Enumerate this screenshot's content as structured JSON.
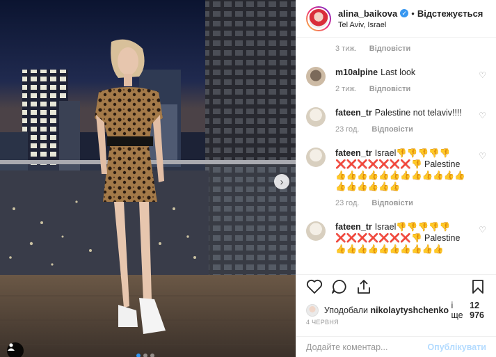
{
  "post": {
    "username": "alina_baikova",
    "follow_state": "Відстежується",
    "separator": "•",
    "location": "Tel Aviv, Israel"
  },
  "comments": [
    {
      "time": "3 тиж.",
      "reply": "Відповісти"
    },
    {
      "user": "m10alpine",
      "text": "Last look",
      "time": "2 тиж.",
      "reply": "Відповісти",
      "avatar_color": "#c9b8a3"
    },
    {
      "user": "fateen_tr",
      "text": "Palestine not telaviv!!!!",
      "time": "23 год.",
      "reply": "Відповісти",
      "avatar_color": "#e8e2d6"
    },
    {
      "user": "fateen_tr",
      "text": "Israel👎👎👎👎👎❌❌❌❌❌❌❌👎 Palestine👍👍👍👍👍👍👍👍👍👍👍👍👍👍👍👍👍👍",
      "time": "23 год.",
      "reply": "Відповісти",
      "avatar_color": "#e8e2d6"
    },
    {
      "user": "fateen_tr",
      "text": "Israel👎👎👎👎👎❌❌❌❌❌❌❌👎 Palestine👍👍👍👍👍👍👍👍👍👍",
      "avatar_color": "#e8e2d6"
    }
  ],
  "likes": {
    "prefix": "Уподобали",
    "user": "nikolaytyshchenko",
    "middle": "і ще",
    "count": "12 976"
  },
  "date": "4 ЧЕРВНЯ",
  "add_comment": {
    "placeholder": "Додайте коментар...",
    "publish_label": "Опублікувати"
  },
  "carousel": {
    "slide_count": 3,
    "active_index": 0
  },
  "colors": {
    "accent": "#3897f0",
    "publish_disabled": "#b3dbff",
    "meta_grey": "#999999"
  }
}
